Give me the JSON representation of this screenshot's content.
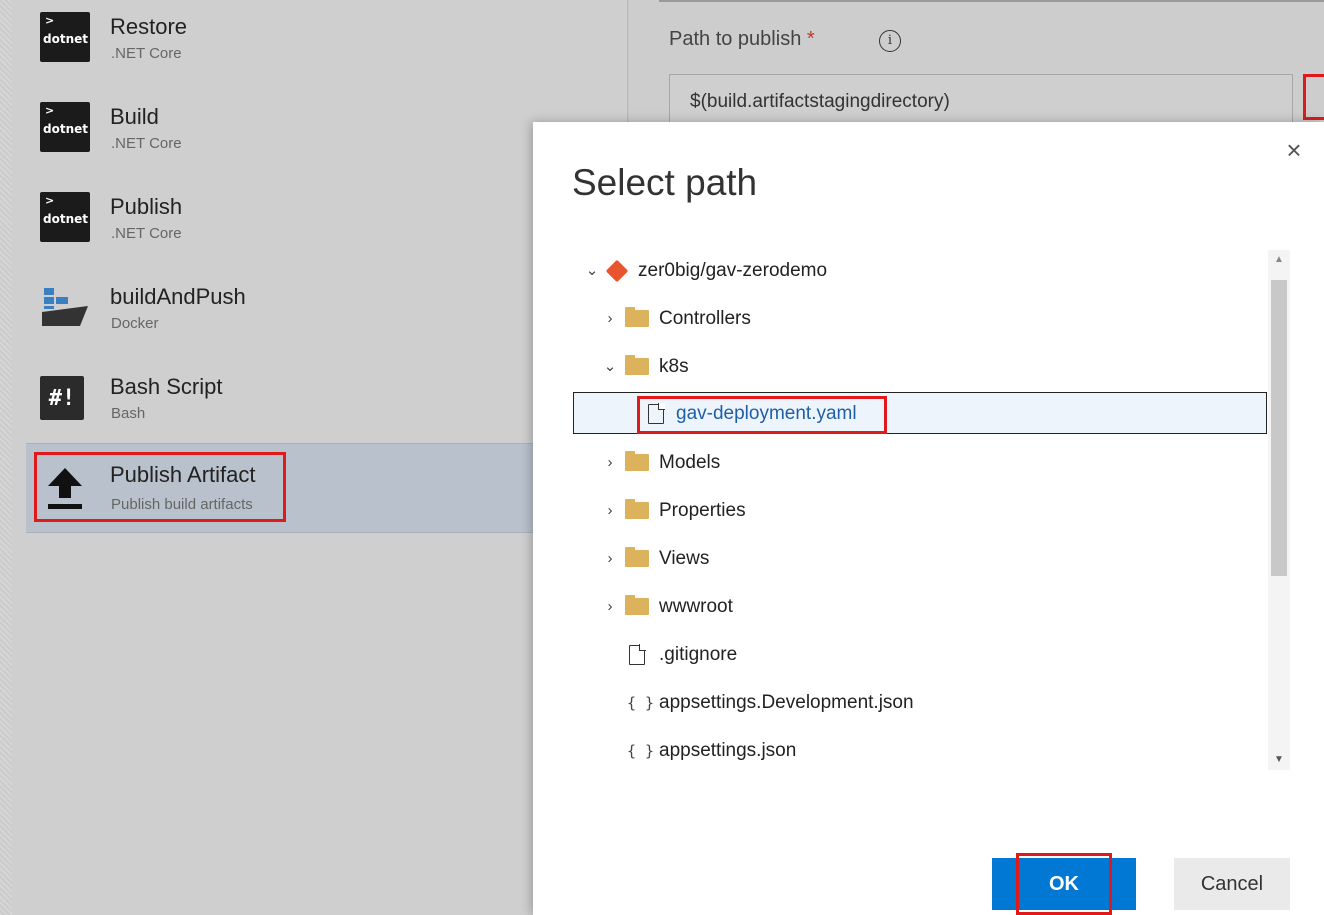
{
  "left_tasks": [
    {
      "title": "Restore",
      "subtitle": ".NET Core",
      "icon": "dotnet-icon",
      "icon_text": "dotnet",
      "icon_chevron": ">"
    },
    {
      "title": "Build",
      "subtitle": ".NET Core",
      "icon": "dotnet-icon",
      "icon_text": "dotnet",
      "icon_chevron": ">"
    },
    {
      "title": "Publish",
      "subtitle": ".NET Core",
      "icon": "dotnet-icon",
      "icon_text": "dotnet",
      "icon_chevron": ">"
    },
    {
      "title": "buildAndPush",
      "subtitle": "Docker",
      "icon": "docker-icon"
    },
    {
      "title": "Bash Script",
      "subtitle": "Bash",
      "icon": "bash-icon",
      "icon_text": "#!"
    },
    {
      "title": "Publish Artifact",
      "subtitle": "Publish build artifacts",
      "icon": "upload-icon",
      "selected": true
    }
  ],
  "path_field": {
    "label": "Path to publish",
    "required_mark": "*",
    "info_glyph": "i",
    "value": "$(build.artifactstagingdirectory)"
  },
  "modal": {
    "title": "Select path",
    "close_glyph": "×",
    "ok_label": "OK",
    "cancel_label": "Cancel",
    "tree": [
      {
        "label": "zer0big/gav-zerodemo",
        "type": "repo",
        "expanded": true
      },
      {
        "label": "Controllers",
        "type": "folder",
        "expanded": false
      },
      {
        "label": "k8s",
        "type": "folder",
        "expanded": true
      },
      {
        "label": "gav-deployment.yaml",
        "type": "file",
        "selected": true
      },
      {
        "label": "Models",
        "type": "folder",
        "expanded": false
      },
      {
        "label": "Properties",
        "type": "folder",
        "expanded": false
      },
      {
        "label": "Views",
        "type": "folder",
        "expanded": false
      },
      {
        "label": "wwwroot",
        "type": "folder",
        "expanded": false
      },
      {
        "label": ".gitignore",
        "type": "file"
      },
      {
        "label": "appsettings.Development.json",
        "type": "json"
      },
      {
        "label": "appsettings.json",
        "type": "json"
      }
    ]
  },
  "colors": {
    "highlight": "#e01a1a",
    "primary": "#0078d4",
    "folder": "#dcb35c",
    "repo": "#e8542e"
  }
}
